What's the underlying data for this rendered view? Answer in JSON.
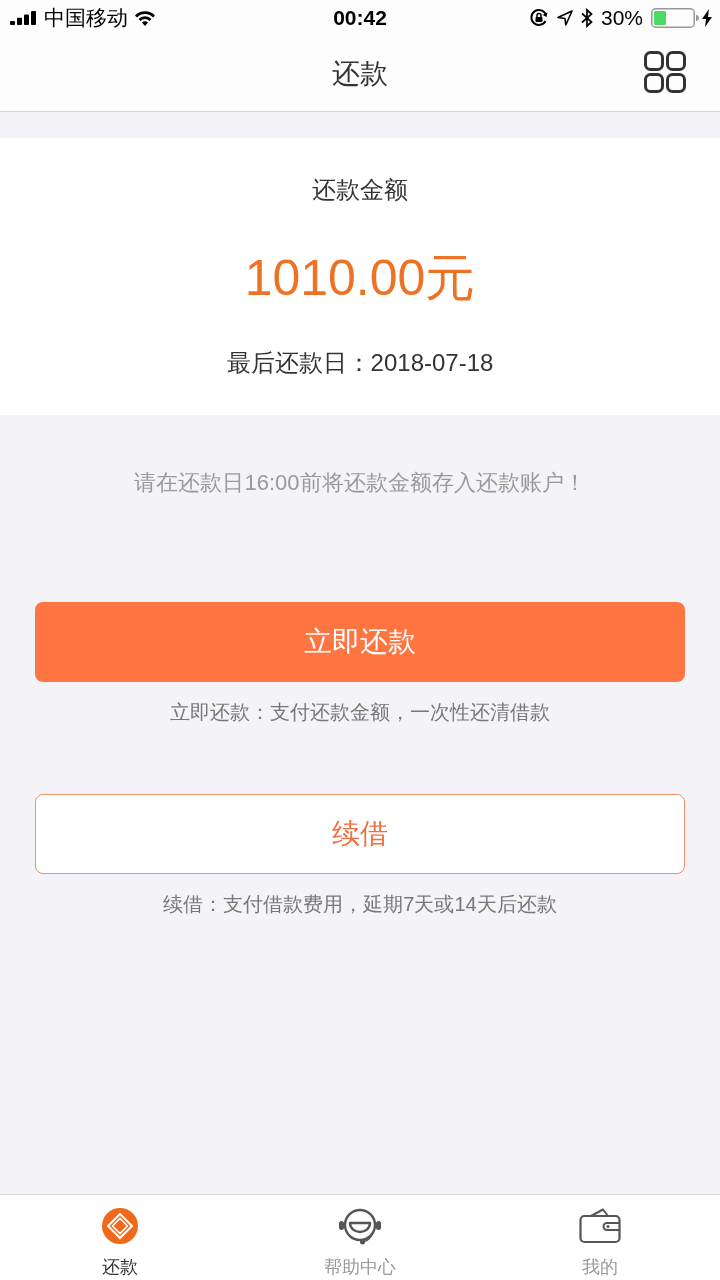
{
  "status_bar": {
    "carrier": "中国移动",
    "time": "00:42",
    "battery_percent": "30%"
  },
  "nav_bar": {
    "title": "还款"
  },
  "amount_card": {
    "label": "还款金额",
    "amount": "1010.00元",
    "due_date": "最后还款日：2018-07-18"
  },
  "notice": "请在还款日16:00前将还款金额存入还款账户！",
  "actions": [
    {
      "kind": "primary",
      "label": "立即还款",
      "hint": "立即还款：支付还款金额，一次性还清借款"
    },
    {
      "kind": "outline",
      "label": "续借",
      "hint": "续借：支付借款费用，延期7天或14天后还款"
    }
  ],
  "tab_bar": [
    {
      "label": "还款",
      "selected": true
    },
    {
      "label": "帮助中心",
      "selected": false
    },
    {
      "label": "我的",
      "selected": false
    }
  ]
}
